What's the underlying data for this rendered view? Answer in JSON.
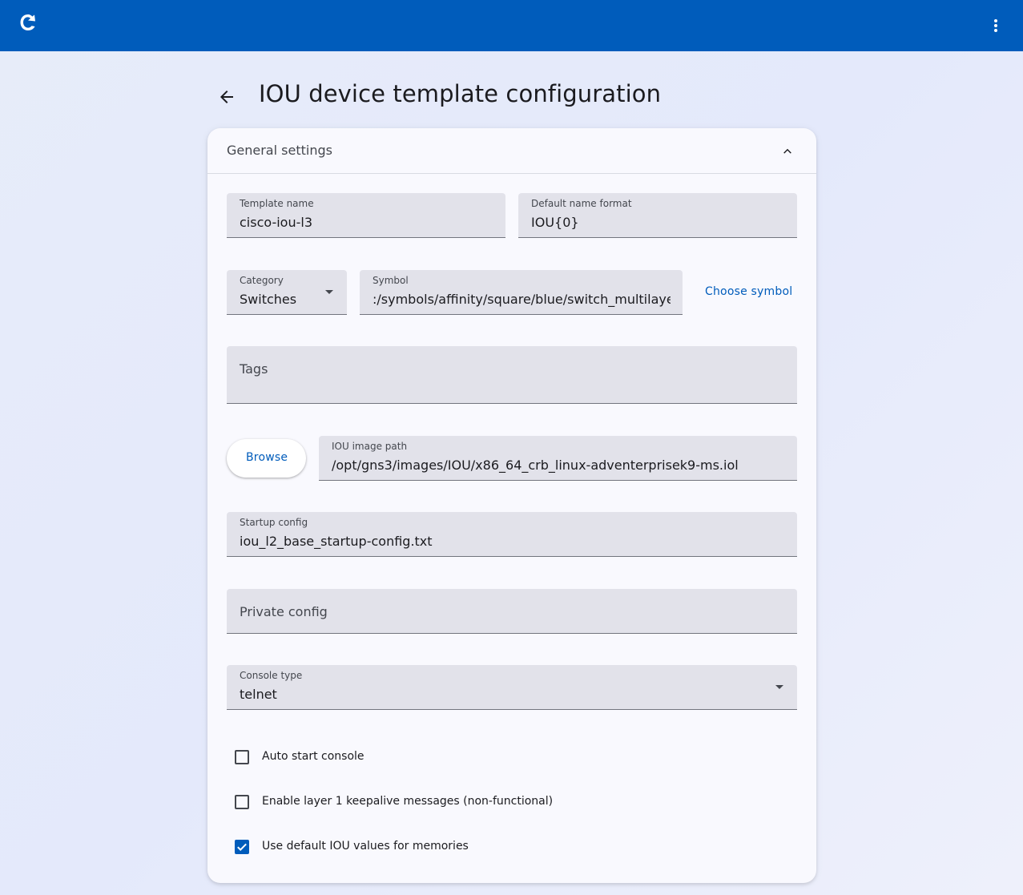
{
  "header": {
    "logo_icon": "gns3-logo-icon",
    "menu_icon": "more-vert-icon",
    "bar_color": "#005cbb"
  },
  "page": {
    "title": "IOU device template configuration",
    "back_icon": "arrow-back-icon"
  },
  "panel": {
    "title": "General settings",
    "expanded": true
  },
  "form": {
    "template_name": {
      "label": "Template name",
      "value": "cisco-iou-l3"
    },
    "default_name_format": {
      "label": "Default name format",
      "value": "IOU{0}"
    },
    "category": {
      "label": "Category",
      "value": "Switches"
    },
    "symbol": {
      "label": "Symbol",
      "value": ":/symbols/affinity/square/blue/switch_multilayer.svg"
    },
    "choose_symbol_label": "Choose symbol",
    "tags": {
      "placeholder": "Tags"
    },
    "browse_label": "Browse",
    "image_path": {
      "label": "IOU image path",
      "value": "/opt/gns3/images/IOU/x86_64_crb_linux-adventerprisek9-ms.iol"
    },
    "startup_config": {
      "label": "Startup config",
      "value": "iou_l2_base_startup-config.txt"
    },
    "private_config": {
      "placeholder": "Private config"
    },
    "console_type": {
      "label": "Console type",
      "value": "telnet"
    },
    "checkboxes": [
      {
        "label": "Auto start console",
        "checked": false
      },
      {
        "label": "Enable layer 1 keepalive messages (non-functional)",
        "checked": false
      },
      {
        "label": "Use default IOU values for memories",
        "checked": true
      }
    ]
  },
  "colors": {
    "accent": "#005cbb",
    "field_bg": "#e2e2ea",
    "card_bg": "#f9f9fe"
  }
}
